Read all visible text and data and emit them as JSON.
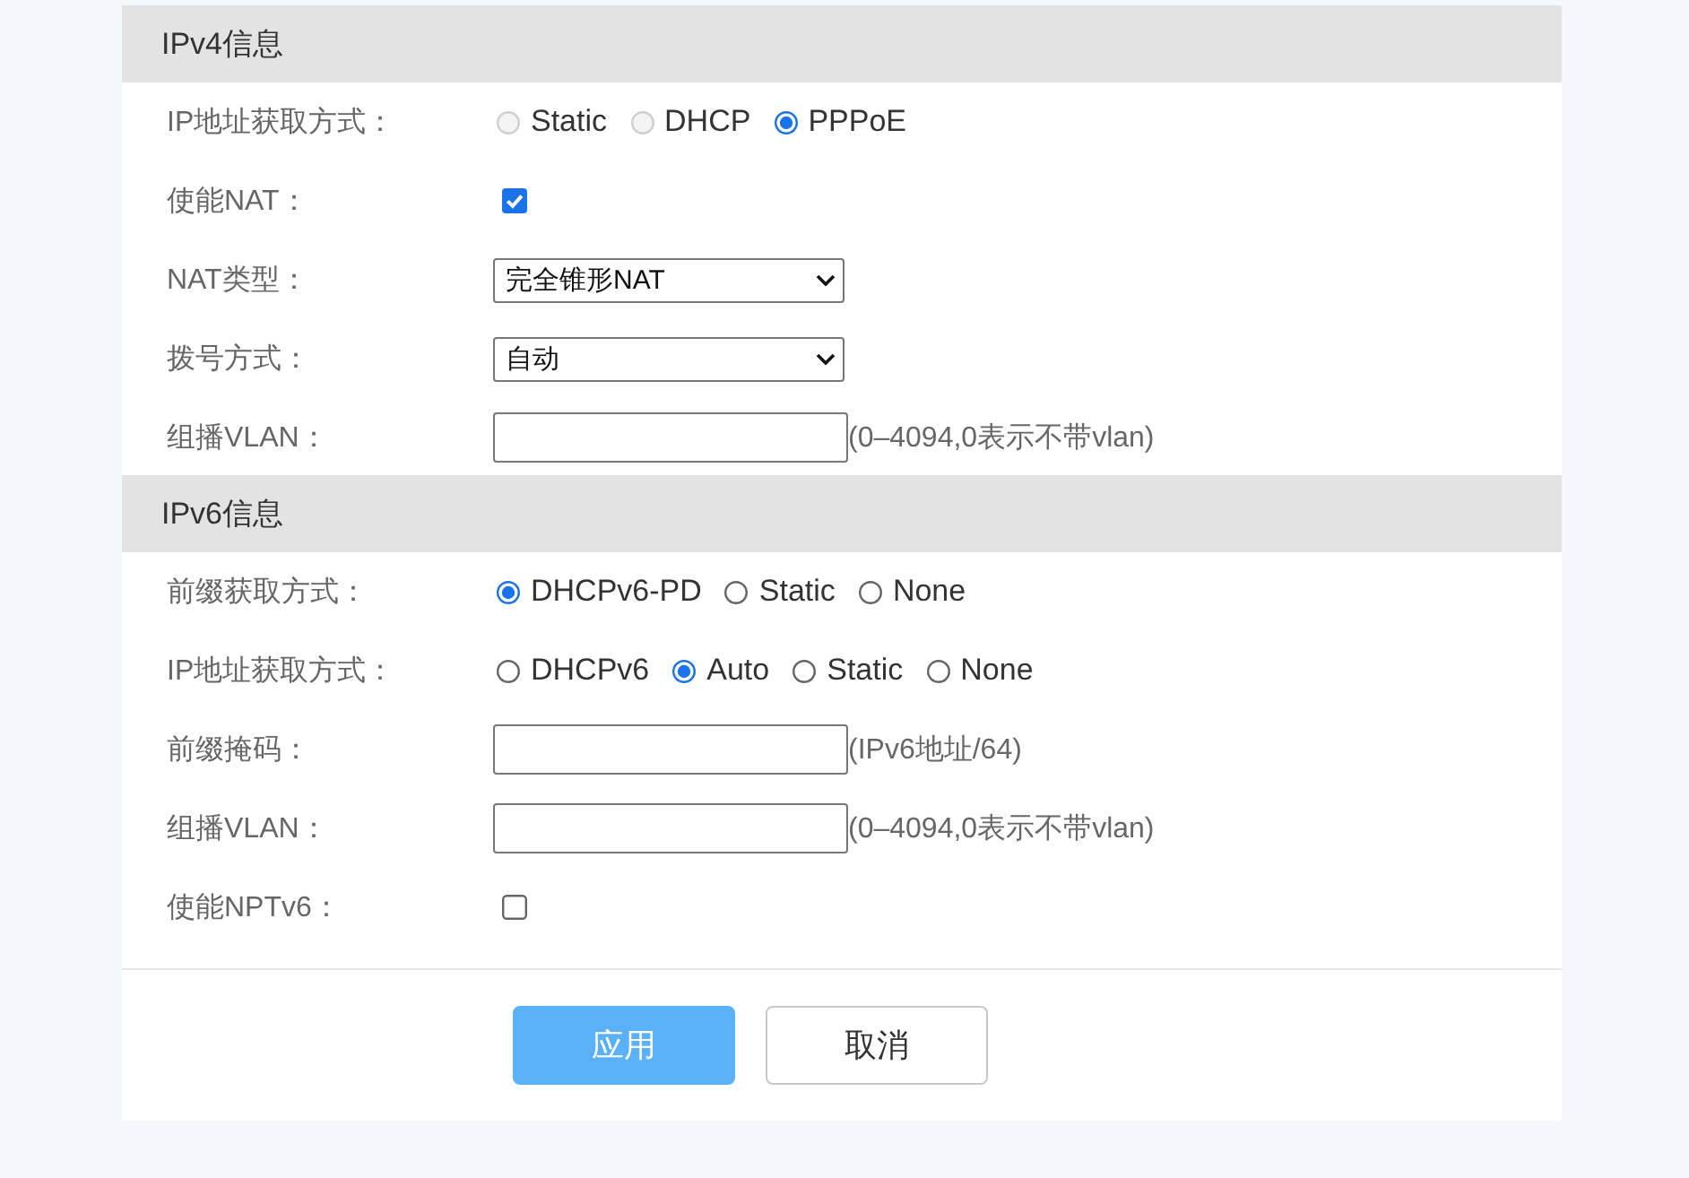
{
  "sections": [
    {
      "title": "IPv4信息",
      "fields": [
        {
          "kind": "radio",
          "label": "IP地址获取方式：",
          "options": [
            {
              "label": "Static",
              "selected": false,
              "disabled": true
            },
            {
              "label": "DHCP",
              "selected": false,
              "disabled": true
            },
            {
              "label": "PPPoE",
              "selected": true,
              "disabled": false
            }
          ]
        },
        {
          "kind": "checkbox",
          "label": "使能NAT：",
          "checked": true
        },
        {
          "kind": "select",
          "label": "NAT类型：",
          "value": "完全锥形NAT"
        },
        {
          "kind": "select",
          "label": "拨号方式：",
          "value": "自动"
        },
        {
          "kind": "input",
          "label": "组播VLAN：",
          "hint": "(0–4094,0表示不带vlan)"
        }
      ]
    },
    {
      "title": "IPv6信息",
      "fields": [
        {
          "kind": "radio",
          "label": "前缀获取方式：",
          "options": [
            {
              "label": "DHCPv6-PD",
              "selected": true,
              "disabled": false
            },
            {
              "label": "Static",
              "selected": false,
              "disabled": false
            },
            {
              "label": "None",
              "selected": false,
              "disabled": false
            }
          ]
        },
        {
          "kind": "radio",
          "label": "IP地址获取方式：",
          "options": [
            {
              "label": "DHCPv6",
              "selected": false,
              "disabled": false
            },
            {
              "label": "Auto",
              "selected": true,
              "disabled": false
            },
            {
              "label": "Static",
              "selected": false,
              "disabled": false
            },
            {
              "label": "None",
              "selected": false,
              "disabled": false
            }
          ]
        },
        {
          "kind": "input",
          "label": "前缀掩码：",
          "hint": "(IPv6地址/64)"
        },
        {
          "kind": "input",
          "label": "组播VLAN：",
          "hint": "(0–4094,0表示不带vlan)"
        },
        {
          "kind": "checkbox",
          "label": "使能NPTv6：",
          "checked": false
        }
      ]
    }
  ],
  "buttons": [
    {
      "label": "应用",
      "kind": "primary"
    },
    {
      "label": "取消",
      "kind": "secondary"
    }
  ]
}
